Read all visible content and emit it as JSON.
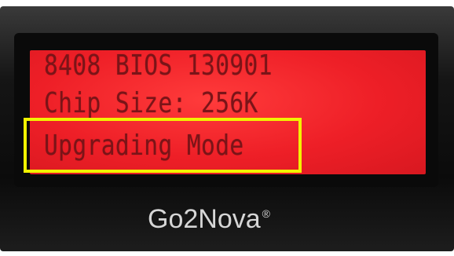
{
  "display": {
    "lines": [
      "8408 BIOS 130901",
      "Chip Size: 256K",
      "Upgrading Mode"
    ],
    "background_color": "#ee1f27",
    "text_color": "#7a1418"
  },
  "highlight": {
    "color": "#f2f200"
  },
  "brand": {
    "name": "Go2Nova",
    "mark": "®"
  }
}
